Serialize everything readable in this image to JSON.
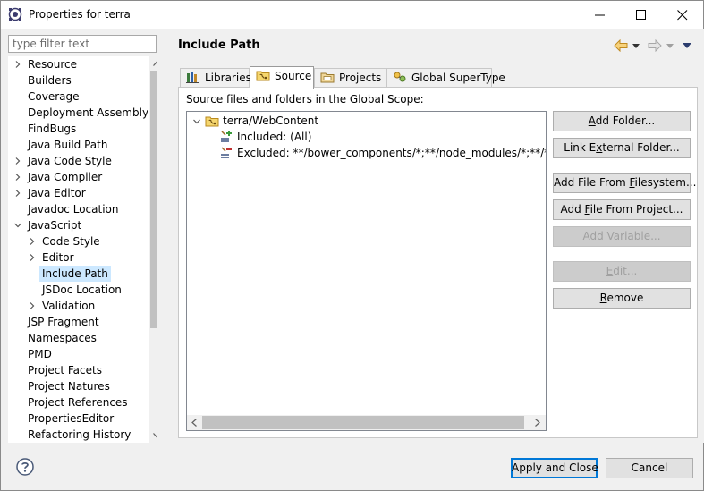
{
  "window": {
    "title": "Properties for terra"
  },
  "filter": {
    "placeholder": "type filter text"
  },
  "sidebar": {
    "items": [
      {
        "label": "Resource",
        "expandable": true,
        "level": 0
      },
      {
        "label": "Builders",
        "expandable": false,
        "level": 0
      },
      {
        "label": "Coverage",
        "expandable": false,
        "level": 0
      },
      {
        "label": "Deployment Assembly",
        "expandable": false,
        "level": 0
      },
      {
        "label": "FindBugs",
        "expandable": false,
        "level": 0
      },
      {
        "label": "Java Build Path",
        "expandable": false,
        "level": 0
      },
      {
        "label": "Java Code Style",
        "expandable": true,
        "level": 0
      },
      {
        "label": "Java Compiler",
        "expandable": true,
        "level": 0
      },
      {
        "label": "Java Editor",
        "expandable": true,
        "level": 0
      },
      {
        "label": "Javadoc Location",
        "expandable": false,
        "level": 0
      },
      {
        "label": "JavaScript",
        "expandable": true,
        "expanded": true,
        "level": 0
      },
      {
        "label": "Code Style",
        "expandable": true,
        "level": 1
      },
      {
        "label": "Editor",
        "expandable": true,
        "level": 1
      },
      {
        "label": "Include Path",
        "expandable": false,
        "level": 1,
        "selected": true
      },
      {
        "label": "JSDoc Location",
        "expandable": false,
        "level": 1
      },
      {
        "label": "Validation",
        "expandable": true,
        "level": 1
      },
      {
        "label": "JSP Fragment",
        "expandable": false,
        "level": 0
      },
      {
        "label": "Namespaces",
        "expandable": false,
        "level": 0
      },
      {
        "label": "PMD",
        "expandable": false,
        "level": 0
      },
      {
        "label": "Project Facets",
        "expandable": false,
        "level": 0
      },
      {
        "label": "Project Natures",
        "expandable": false,
        "level": 0
      },
      {
        "label": "Project References",
        "expandable": false,
        "level": 0
      },
      {
        "label": "PropertiesEditor",
        "expandable": false,
        "level": 0
      },
      {
        "label": "Refactoring History",
        "expandable": false,
        "level": 0
      }
    ]
  },
  "page": {
    "title": "Include Path"
  },
  "tabs": [
    {
      "label": "Libraries",
      "icon": "libraries-icon",
      "active": false
    },
    {
      "label": "Source",
      "icon": "source-folder-icon",
      "active": true
    },
    {
      "label": "Projects",
      "icon": "projects-icon",
      "active": false
    },
    {
      "label": "Global SuperType",
      "icon": "supertype-icon",
      "active": false
    }
  ],
  "source": {
    "section_label": "Source files and folders in the Global Scope:",
    "tree": [
      {
        "label": "terra/WebContent",
        "icon": "source-folder-icon",
        "level": 0,
        "expanded": true
      },
      {
        "label": "Included: (All)",
        "icon": "inclusion-filter-icon",
        "level": 1
      },
      {
        "label": "Excluded: **/bower_components/*;**/node_modules/*;**/*.min.j",
        "icon": "exclusion-filter-icon",
        "level": 1
      }
    ]
  },
  "buttons": {
    "add_folder": {
      "pre": "",
      "u": "A",
      "post": "dd Folder..."
    },
    "link_external": {
      "pre": "Link E",
      "u": "x",
      "post": "ternal Folder..."
    },
    "add_file_fs": {
      "pre": "Add File From ",
      "u": "F",
      "post": "ilesystem..."
    },
    "add_file_project": {
      "pre": "Add ",
      "u": "F",
      "post": "ile From Project..."
    },
    "add_variable": {
      "pre": "Add ",
      "u": "V",
      "post": "ariable..."
    },
    "edit": {
      "pre": "",
      "u": "E",
      "post": "dit..."
    },
    "remove": {
      "pre": "",
      "u": "R",
      "post": "emove"
    }
  },
  "footer": {
    "apply_close": "Apply and Close",
    "cancel": "Cancel"
  },
  "colors": {
    "selection": "#cce8ff",
    "primary_border": "#0078d7",
    "nav_arrow": "#e8a530"
  }
}
